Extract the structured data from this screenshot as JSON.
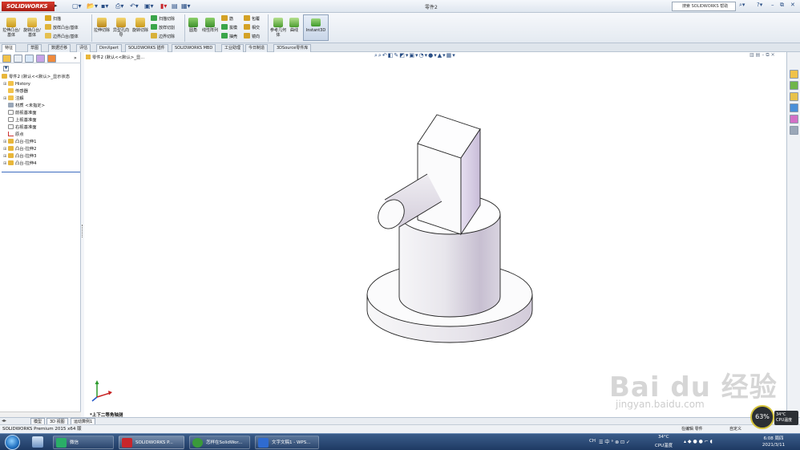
{
  "titlebar": {
    "brand": "SOLIDWORKS",
    "document_title": "零件2",
    "help_search_placeholder": "搜索 SOLIDWORKS 帮助",
    "icons": [
      "new-icon",
      "open-icon",
      "save-icon",
      "print-icon",
      "undo-icon",
      "select-icon",
      "rebuild-icon",
      "file-properties-icon",
      "options-icon"
    ]
  },
  "commands": {
    "extrude_boss": "拉伸凸台/基体",
    "revolve_boss": "旋转凸台/基体",
    "sweep": "扫描",
    "loft": "放样凸台/基体",
    "boundary_boss": "边界凸台/基体",
    "extrude_cut": "拉伸切除",
    "hole_wizard": "异型孔向导",
    "revolve_cut": "旋转切除",
    "swept_cut": "扫描切除",
    "lofted_cut": "放样切割",
    "boundary_cut": "边界切除",
    "fillet": "圆角",
    "linear_pattern": "线性阵列",
    "rib": "筋",
    "draft": "拔模",
    "shell": "抽壳",
    "wrap": "包覆",
    "intersect": "相交",
    "mirror": "镜向",
    "reference_geometry": "参考几何体",
    "curves": "曲线",
    "instant3d": "Instant3D"
  },
  "tabs": [
    "特征",
    "草图",
    "数据迁移",
    "评估",
    "DimXpert",
    "SOLIDWORKS 插件",
    "SOLIDWORKS MBD",
    "工业助理",
    "今日制造",
    "3DSource零件库"
  ],
  "feature_tree": {
    "root": "零件2 (默认<<默认>_显示状态",
    "items": [
      {
        "label": "History",
        "icon": "history-icon",
        "expandable": true
      },
      {
        "label": "传感器",
        "icon": "sensor-icon",
        "expandable": false
      },
      {
        "label": "注解",
        "icon": "annotations-icon",
        "expandable": true
      },
      {
        "label": "材质 <未指定>",
        "icon": "material-icon",
        "expandable": false
      },
      {
        "label": "前视基准面",
        "icon": "plane-icon",
        "expandable": false
      },
      {
        "label": "上视基准面",
        "icon": "plane-icon",
        "expandable": false
      },
      {
        "label": "右视基准面",
        "icon": "plane-icon",
        "expandable": false
      },
      {
        "label": "原点",
        "icon": "origin-icon",
        "expandable": false
      },
      {
        "label": "凸台-拉伸1",
        "icon": "boss-extrude-icon",
        "expandable": true
      },
      {
        "label": "凸台-拉伸2",
        "icon": "boss-extrude-icon",
        "expandable": true
      },
      {
        "label": "凸台-拉伸3",
        "icon": "boss-extrude-icon",
        "expandable": true
      },
      {
        "label": "凸台-拉伸4",
        "icon": "boss-extrude-icon",
        "expandable": true
      }
    ]
  },
  "viewport": {
    "breadcrumb": "零件2 (默认<<默认>_显...",
    "view_label": "*上下二等角轴测"
  },
  "bottom_tabs": [
    "模型",
    "3D 视图",
    "运动算例1"
  ],
  "status": {
    "product": "SOLIDWORKS Premium 2015 x64 版",
    "mode": "在编辑 零件",
    "units": "自定义"
  },
  "taskbar": {
    "apps": [
      {
        "label": "微信",
        "color": "#2aae67"
      },
      {
        "label": "SOLIDWORKS P...",
        "color": "#c8262b"
      },
      {
        "label": "怎样在SolidWor...",
        "color": "#3a9a3a"
      },
      {
        "label": "文字文稿1 - WPS...",
        "color": "#2f6bd0"
      }
    ],
    "tray_text": "CH",
    "temperature": "34°C",
    "temperature_label": "CPU温度",
    "time": "6:08 周四",
    "date": "2021/3/11"
  },
  "overlay": {
    "cpu_percent": "63%",
    "cpu_temp": "34°C",
    "cpu_temp_label": "CPU温度",
    "watermark": "Bai du 经验",
    "watermark_url": "jingyan.baidu.com"
  },
  "colors": {
    "brand_red": "#c8262b",
    "selection_blue": "#3d6cc0",
    "model_face": "#dcd7e2",
    "taskbar": "#1e3a63"
  }
}
